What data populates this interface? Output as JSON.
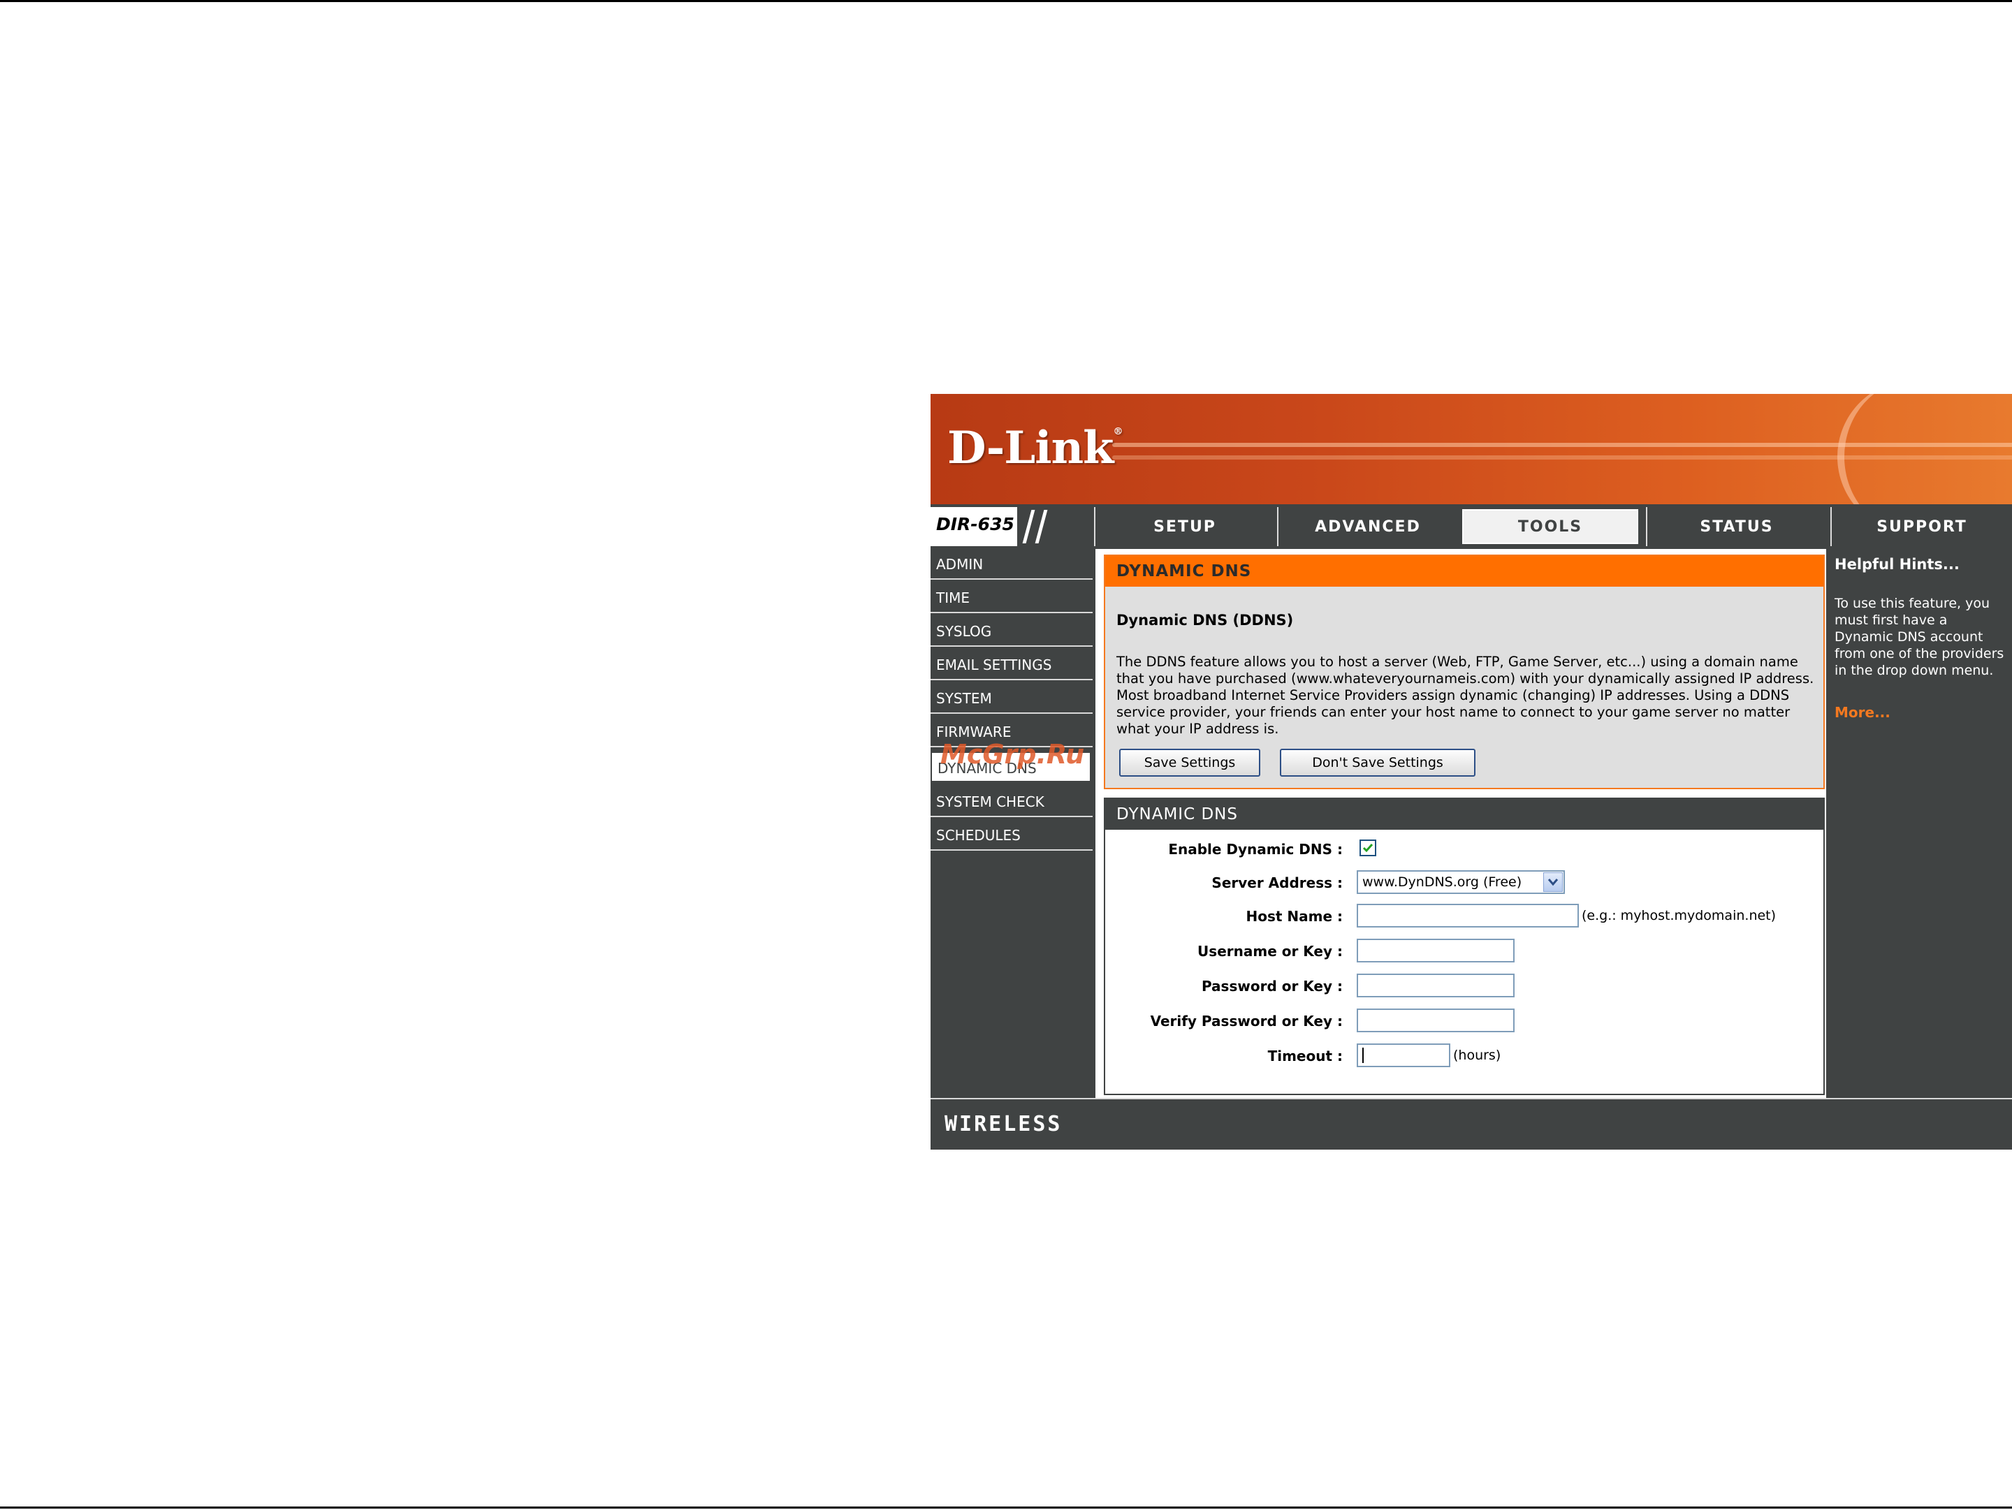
{
  "brand": {
    "logo": "D-Link",
    "registered": "®",
    "model": "DIR-635"
  },
  "nav": {
    "tabs": [
      "SETUP",
      "ADVANCED",
      "TOOLS",
      "STATUS",
      "SUPPORT"
    ],
    "active": "TOOLS"
  },
  "sidebar": {
    "items": [
      "ADMIN",
      "TIME",
      "SYSLOG",
      "EMAIL SETTINGS",
      "SYSTEM",
      "FIRMWARE",
      "DYNAMIC DNS",
      "SYSTEM CHECK",
      "SCHEDULES"
    ],
    "active": "DYNAMIC DNS"
  },
  "intro": {
    "header": "DYNAMIC DNS",
    "subtitle": "Dynamic DNS (DDNS)",
    "description": "The DDNS feature allows you to host a server (Web, FTP, Game Server, etc...) using a domain name that you have purchased (www.whateveryournameis.com) with your dynamically assigned IP address. Most broadband Internet Service Providers assign dynamic (changing) IP addresses. Using a DDNS service provider, your friends can enter your host name to connect to your game server no matter what your IP address is.",
    "save_label": "Save Settings",
    "dont_save_label": "Don't Save Settings"
  },
  "form": {
    "header": "DYNAMIC DNS",
    "enable_label": "Enable Dynamic DNS :",
    "enable_checked": true,
    "server_label": "Server Address :",
    "server_value": "www.DynDNS.org (Free)",
    "host_label": "Host Name :",
    "host_value": "",
    "host_hint": "(e.g.: myhost.mydomain.net)",
    "username_label": "Username or Key :",
    "username_value": "",
    "password_label": "Password or Key :",
    "verify_label": "Verify Password or Key :",
    "timeout_label": "Timeout :",
    "timeout_value": "",
    "timeout_hint": "(hours)"
  },
  "hints": {
    "title": "Helpful Hints...",
    "text": "To use this feature, you must first have a Dynamic DNS account from one of the providers in the drop down menu.",
    "more": "More..."
  },
  "footer": {
    "logo": "WIRELESS"
  },
  "watermark": "McGrp.Ru",
  "colors": {
    "orange": "#ff6f00",
    "dark": "#404343",
    "link": "#f47920"
  }
}
